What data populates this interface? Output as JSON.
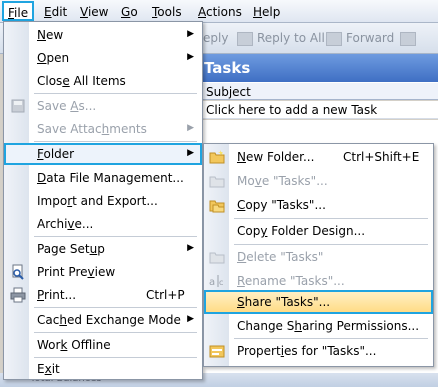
{
  "menubar": {
    "items": [
      {
        "label": "File",
        "key": "F",
        "rest": "ile"
      },
      {
        "label": "Edit",
        "key": "E",
        "rest": "dit"
      },
      {
        "label": "View",
        "key": "V",
        "rest": "iew"
      },
      {
        "label": "Go",
        "key": "G",
        "rest": "o"
      },
      {
        "label": "Tools",
        "key": "T",
        "rest": "ools"
      },
      {
        "label": "Actions",
        "key": "A",
        "rest": "ctions"
      },
      {
        "label": "Help",
        "key": "H",
        "rest": "elp"
      }
    ]
  },
  "toolbar": {
    "reply": "eply",
    "reply_all": "Reply to All",
    "forward": "Forward"
  },
  "tasks": {
    "header": "Tasks",
    "column_subject": "Subject",
    "add_placeholder": "Click here to add a new Task"
  },
  "file_menu": {
    "items": [
      {
        "pre": "",
        "key": "N",
        "post": "ew",
        "shortcut": "",
        "submenu": true,
        "disabled": false
      },
      {
        "pre": "",
        "key": "O",
        "post": "pen",
        "shortcut": "",
        "submenu": true,
        "disabled": false
      },
      {
        "pre": "Clos",
        "key": "e",
        "post": " All Items",
        "shortcut": "",
        "submenu": false,
        "disabled": false
      },
      {
        "pre": "Save ",
        "key": "A",
        "post": "s...",
        "shortcut": "",
        "submenu": false,
        "disabled": true
      },
      {
        "pre": "Save Attac",
        "key": "h",
        "post": "ments",
        "shortcut": "",
        "submenu": true,
        "disabled": true
      },
      {
        "pre": "",
        "key": "F",
        "post": "older",
        "shortcut": "",
        "submenu": true,
        "disabled": false
      },
      {
        "pre": "",
        "key": "D",
        "post": "ata File Management...",
        "shortcut": "",
        "submenu": false,
        "disabled": false
      },
      {
        "pre": "Impo",
        "key": "r",
        "post": "t and Export...",
        "shortcut": "",
        "submenu": false,
        "disabled": false
      },
      {
        "pre": "Archi",
        "key": "v",
        "post": "e...",
        "shortcut": "",
        "submenu": false,
        "disabled": false
      },
      {
        "pre": "Page Set",
        "key": "u",
        "post": "p",
        "shortcut": "",
        "submenu": true,
        "disabled": false
      },
      {
        "pre": "Print Pre",
        "key": "v",
        "post": "iew",
        "shortcut": "",
        "submenu": false,
        "disabled": false
      },
      {
        "pre": "",
        "key": "P",
        "post": "rint...",
        "shortcut": "Ctrl+P",
        "submenu": false,
        "disabled": false
      },
      {
        "pre": "Cac",
        "key": "h",
        "post": "ed Exchange Mode",
        "shortcut": "",
        "submenu": true,
        "disabled": false
      },
      {
        "pre": "Wor",
        "key": "k",
        "post": " Offline",
        "shortcut": "",
        "submenu": false,
        "disabled": false
      },
      {
        "pre": "E",
        "key": "x",
        "post": "it",
        "shortcut": "",
        "submenu": false,
        "disabled": false
      }
    ]
  },
  "folder_submenu": {
    "items": [
      {
        "pre": "",
        "key": "N",
        "post": "ew Folder...",
        "shortcut": "Ctrl+Shift+E",
        "disabled": false
      },
      {
        "pre": "Mo",
        "key": "v",
        "post": "e \"Tasks\"...",
        "shortcut": "",
        "disabled": true
      },
      {
        "pre": "",
        "key": "C",
        "post": "opy \"Tasks\"...",
        "shortcut": "",
        "disabled": false
      },
      {
        "pre": "Cop",
        "key": "y",
        "post": " Folder Design...",
        "shortcut": "",
        "disabled": false
      },
      {
        "pre": "",
        "key": "D",
        "post": "elete \"Tasks\"",
        "shortcut": "",
        "disabled": true
      },
      {
        "pre": "",
        "key": "R",
        "post": "ename \"Tasks\"...",
        "shortcut": "",
        "disabled": true
      },
      {
        "pre": "",
        "key": "S",
        "post": "hare \"Tasks\"...",
        "shortcut": "",
        "disabled": false
      },
      {
        "pre": "Change S",
        "key": "h",
        "post": "aring Permissions...",
        "shortcut": "",
        "disabled": false
      },
      {
        "pre": "Propert",
        "key": "i",
        "post": "es for \"Tasks\"...",
        "shortcut": "",
        "disabled": false
      }
    ]
  },
  "statusbar": {
    "text": "Total Balances"
  },
  "colors": {
    "highlight_border": "#1fa4e0",
    "share_highlight": "#ffdc86",
    "disabled_text": "#9aa1ab"
  }
}
